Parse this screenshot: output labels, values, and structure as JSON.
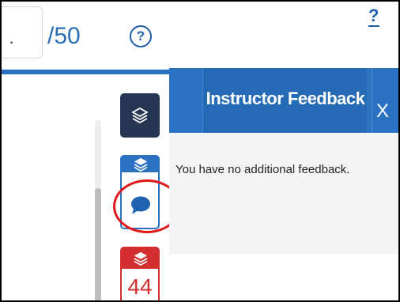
{
  "score": {
    "value": "·",
    "max_label": "/50"
  },
  "help": {
    "label": "?",
    "top_label": "?"
  },
  "side_buttons": [
    {
      "name": "layers-dark",
      "icon": "layers-icon",
      "color": "#263552"
    },
    {
      "name": "feedback",
      "icon": "chat-bubble-icon",
      "color": "#2a72c1"
    },
    {
      "name": "alerts",
      "icon": "layers-icon",
      "color": "#d32f2f",
      "count": "44"
    }
  ],
  "feedback_panel": {
    "title": "Instructor Feedback",
    "close_label": "X",
    "message": "You have no additional feedback."
  },
  "colors": {
    "primary_blue": "#2a72c1",
    "dark_navy": "#263552",
    "alert_red": "#d32f2f",
    "highlight_circle": "#e01818"
  }
}
